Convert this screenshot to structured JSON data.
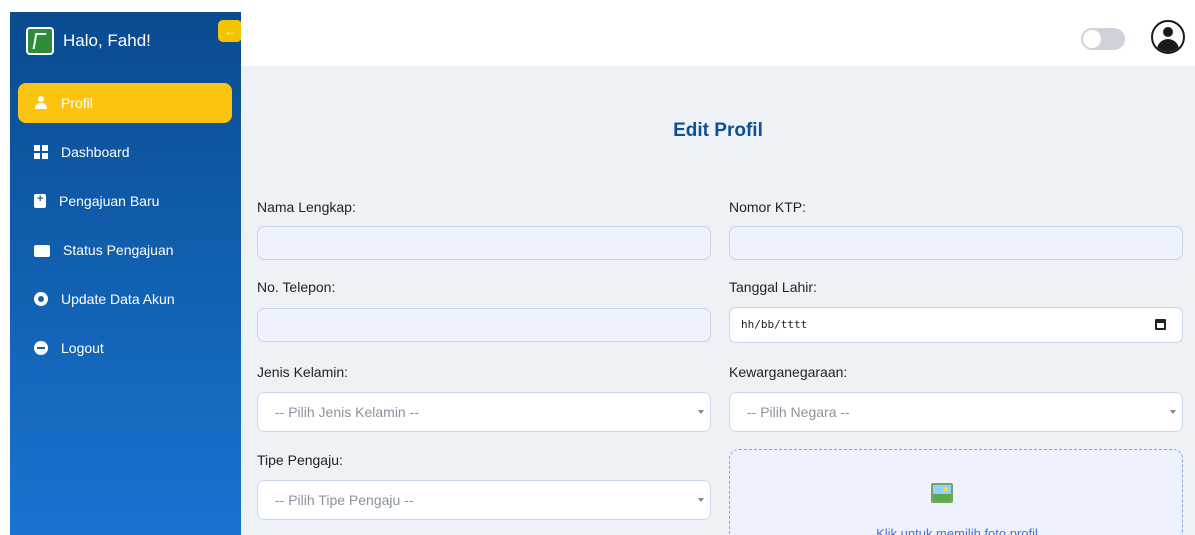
{
  "sidebar": {
    "brand_title": "Halo, Fahd!",
    "collapse_glyph": "←",
    "items": [
      {
        "label": "Profil",
        "icon": "user-icon",
        "active": true
      },
      {
        "label": "Dashboard",
        "icon": "dashboard-icon"
      },
      {
        "label": "Pengajuan Baru",
        "icon": "file-plus-icon"
      },
      {
        "label": "Status Pengajuan",
        "icon": "folder-icon"
      },
      {
        "label": "Update Data Akun",
        "icon": "gear-icon"
      },
      {
        "label": "Logout",
        "icon": "logout-icon"
      }
    ],
    "colors": {
      "background": "#0a4b8f",
      "active": "#fbc410"
    }
  },
  "topbar": {
    "theme_toggle_icon": "toggle-icon",
    "avatar_icon": "user-circle-icon"
  },
  "main": {
    "title": "Edit Profil",
    "fields": {
      "nama_lengkap": {
        "label": "Nama Lengkap:",
        "value": ""
      },
      "nomor_ktp": {
        "label": "Nomor KTP:",
        "value": ""
      },
      "no_telepon": {
        "label": "No. Telepon:",
        "value": ""
      },
      "tanggal_lahir": {
        "label": "Tanggal Lahir:",
        "placeholder": "hh/bb/tttt"
      },
      "jenis_kelamin": {
        "label": "Jenis Kelamin:",
        "selected": "-- Pilih Jenis Kelamin --"
      },
      "kewarganegaraan": {
        "label": "Kewarganegaraan:",
        "selected": "-- Pilih Negara --"
      },
      "tipe_pengaju": {
        "label": "Tipe Pengaju:",
        "selected": "-- Pilih Tipe Pengaju --"
      }
    },
    "upload": {
      "icon": "image-icon",
      "text": "Klik untuk memilih foto profil"
    },
    "colors": {
      "title": "#0e4f96",
      "upload_text": "#4a6fd1"
    }
  }
}
